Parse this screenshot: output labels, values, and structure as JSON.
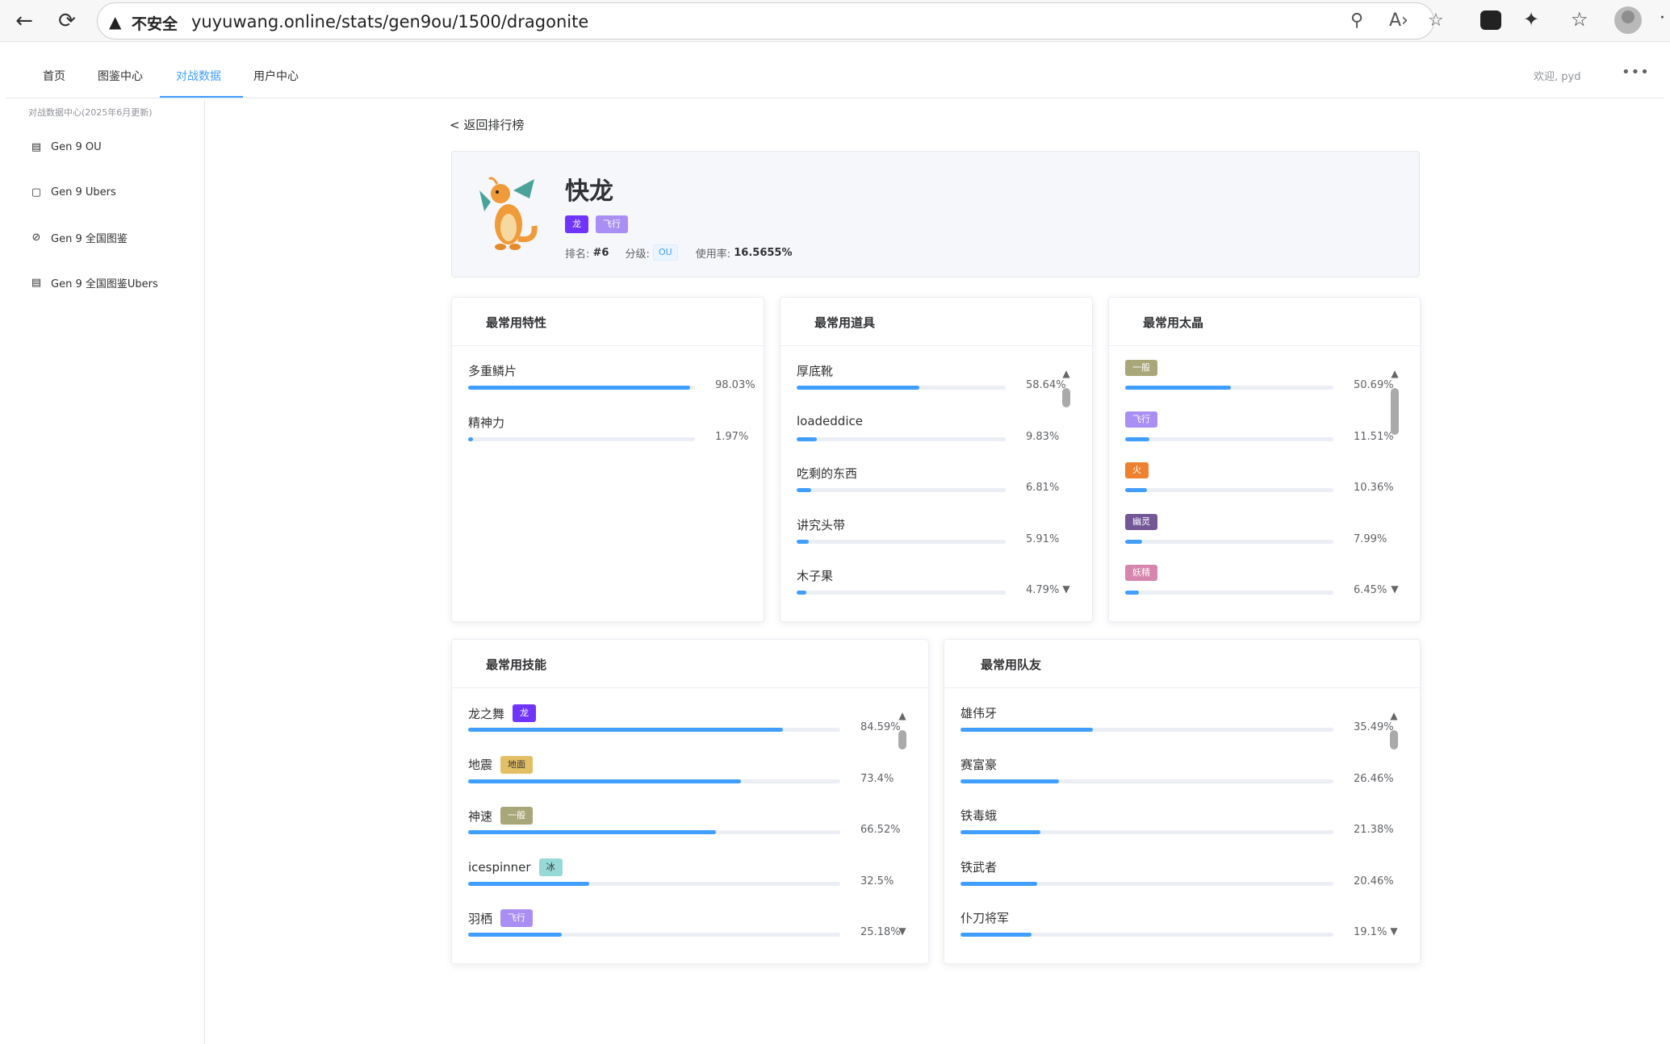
{
  "browser": {
    "insecure_label": "不安全",
    "url": "yuyuwang.online/stats/gen9ou/1500/dragonite"
  },
  "topnav": {
    "items": [
      "首页",
      "图鉴中心",
      "对战数据",
      "用户中心"
    ],
    "active_index": 2,
    "welcome": "欢迎, pyd",
    "more": "•••"
  },
  "sidebar": {
    "group_title": "对战数据中心(2025年6月更新)",
    "items": [
      {
        "label": "Gen 9 OU",
        "icon": "trend-chart-icon"
      },
      {
        "label": "Gen 9 Ubers",
        "icon": "box-icon"
      },
      {
        "label": "Gen 9 全国图鉴",
        "icon": "compass-icon"
      },
      {
        "label": "Gen 9 全国图鉴Ubers",
        "icon": "document-icon"
      }
    ]
  },
  "back_link": "< 返回排行榜",
  "pokemon": {
    "name": "快龙",
    "types": [
      {
        "label": "龙",
        "color": "#6f35fc"
      },
      {
        "label": "飞行",
        "color": "#a98ff3"
      }
    ],
    "rank_label": "排名:",
    "rank": "#6",
    "tier_label": "分级:",
    "tier": "OU",
    "usage_label": "使用率:",
    "usage": "16.5655%"
  },
  "abilities": {
    "title": "最常用特性",
    "rows": [
      {
        "label": "多重鳞片",
        "pct": "98.03%",
        "value": 98.03
      },
      {
        "label": "精神力",
        "pct": "1.97%",
        "value": 1.97
      }
    ]
  },
  "items": {
    "title": "最常用道具",
    "rows": [
      {
        "label": "厚底靴",
        "pct": "58.64%",
        "value": 58.64
      },
      {
        "label": "loadeddice",
        "pct": "9.83%",
        "value": 9.83
      },
      {
        "label": "吃剩的东西",
        "pct": "6.81%",
        "value": 6.81
      },
      {
        "label": "讲究头带",
        "pct": "5.91%",
        "value": 5.91
      },
      {
        "label": "木子果",
        "pct": "4.79%",
        "value": 4.79
      }
    ]
  },
  "tera": {
    "title": "最常用太晶",
    "rows": [
      {
        "tag": "一般",
        "color": "#a8a77a",
        "pct": "50.69%",
        "value": 50.69
      },
      {
        "tag": "飞行",
        "color": "#a98ff3",
        "pct": "11.51%",
        "value": 11.51
      },
      {
        "tag": "火",
        "color": "#ee8130",
        "pct": "10.36%",
        "value": 10.36
      },
      {
        "tag": "幽灵",
        "color": "#735797",
        "pct": "7.99%",
        "value": 7.99
      },
      {
        "tag": "妖精",
        "color": "#d685ad",
        "pct": "6.45%",
        "value": 6.45
      }
    ]
  },
  "moves": {
    "title": "最常用技能",
    "rows": [
      {
        "label": "龙之舞",
        "tag": "龙",
        "color": "#6f35fc",
        "pct": "84.59%",
        "value": 84.59
      },
      {
        "label": "地震",
        "tag": "地面",
        "color": "#e2bf65",
        "pct": "73.4%",
        "value": 73.4
      },
      {
        "label": "神速",
        "tag": "一般",
        "color": "#a8a77a",
        "pct": "66.52%",
        "value": 66.52
      },
      {
        "label": "icespinner",
        "tag": "冰",
        "color": "#96d9d6",
        "pct": "32.5%",
        "value": 32.5
      },
      {
        "label": "羽栖",
        "tag": "飞行",
        "color": "#a98ff3",
        "pct": "25.18%",
        "value": 25.18
      }
    ]
  },
  "teammates": {
    "title": "最常用队友",
    "rows": [
      {
        "label": "雄伟牙",
        "pct": "35.49%",
        "value": 35.49
      },
      {
        "label": "赛富豪",
        "pct": "26.46%",
        "value": 26.46
      },
      {
        "label": "铁毒蛾",
        "pct": "21.38%",
        "value": 21.38
      },
      {
        "label": "铁武者",
        "pct": "20.46%",
        "value": 20.46
      },
      {
        "label": "仆刀将军",
        "pct": "19.1%",
        "value": 19.1
      }
    ]
  }
}
